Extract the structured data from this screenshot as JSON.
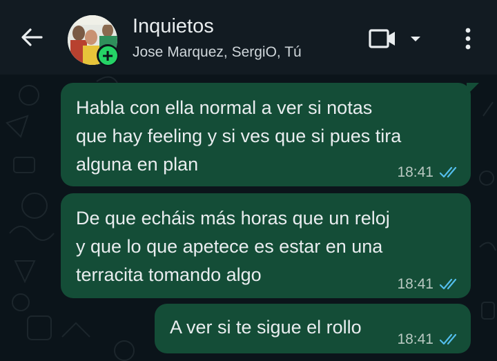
{
  "header": {
    "title": "Inquietos",
    "participants": "Jose Marquez, SergiO, Tú",
    "back_icon": "arrow-left-icon",
    "video_icon": "video-camera-icon",
    "menu_icon": "more-vertical-icon"
  },
  "colors": {
    "header_bg": "#121b22",
    "chat_bg": "#0b141a",
    "outgoing_bubble": "#144d37",
    "read_ticks": "#53bdeb",
    "badge": "#25d366"
  },
  "messages": [
    {
      "lines": [
        "Habla con ella normal a ver si notas",
        "que hay feeling y si ves que si pues tira",
        "alguna en plan"
      ],
      "time": "18:41",
      "status": "read"
    },
    {
      "lines": [
        "De que echáis más horas que un reloj",
        "y que lo que apetece es estar en una",
        "terracita tomando algo"
      ],
      "time": "18:41",
      "status": "read"
    },
    {
      "lines": [
        "A ver si te sigue el rollo"
      ],
      "time": "18:41",
      "status": "read"
    }
  ]
}
